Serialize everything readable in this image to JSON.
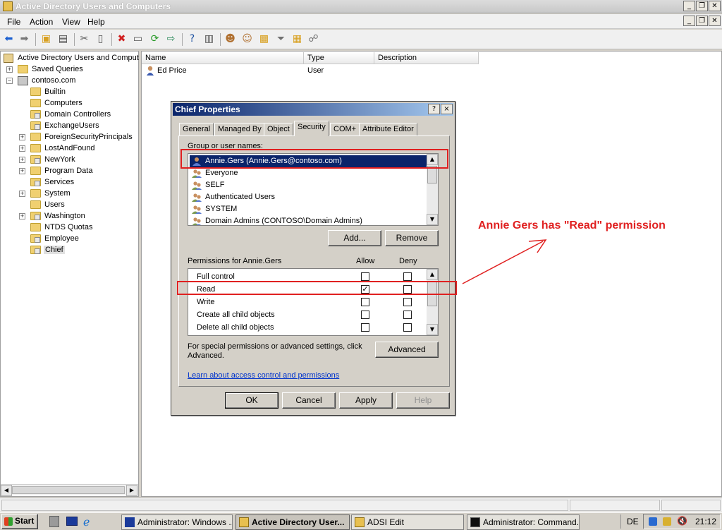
{
  "window": {
    "title": "Active Directory Users and Computers"
  },
  "menu": [
    "File",
    "Action",
    "View",
    "Help"
  ],
  "tree": {
    "root": "Active Directory Users and Comput",
    "items": [
      "Saved Queries",
      "contoso.com",
      "Builtin",
      "Computers",
      "Domain Controllers",
      "ExchangeUsers",
      "ForeignSecurityPrincipals",
      "LostAndFound",
      "NewYork",
      "Program Data",
      "Services",
      "System",
      "Users",
      "Washington",
      "NTDS Quotas",
      "Employee",
      "Chief"
    ]
  },
  "list": {
    "headers": {
      "name": "Name",
      "type": "Type",
      "description": "Description"
    },
    "rows": [
      {
        "name": "Ed Price",
        "type": "User",
        "description": ""
      }
    ]
  },
  "dialog": {
    "title": "Chief Properties",
    "help": "?",
    "close": "×",
    "tabs": [
      "General",
      "Managed By",
      "Object",
      "Security",
      "COM+",
      "Attribute Editor"
    ],
    "group_label": "Group or user names:",
    "users": [
      "Annie.Gers (Annie.Gers@contoso.com)",
      "Everyone",
      "SELF",
      "Authenticated Users",
      "SYSTEM",
      "Domain Admins (CONTOSO\\Domain Admins)"
    ],
    "add": "Add...",
    "remove": "Remove",
    "perm_label": "Permissions for Annie.Gers",
    "allow": "Allow",
    "deny": "Deny",
    "permissions": [
      {
        "name": "Full control",
        "allow": "",
        "deny": ""
      },
      {
        "name": "Read",
        "allow": "✓",
        "deny": ""
      },
      {
        "name": "Write",
        "allow": "",
        "deny": ""
      },
      {
        "name": "Create all child objects",
        "allow": "",
        "deny": ""
      },
      {
        "name": "Delete all child objects",
        "allow": "",
        "deny": ""
      }
    ],
    "special_text": "For special permissions or advanced settings, click Advanced.",
    "advanced": "Advanced",
    "learn_link": "Learn about access control and permissions",
    "ok": "OK",
    "cancel": "Cancel",
    "apply": "Apply",
    "helpbtn": "Help"
  },
  "annotation": "Annie Gers has \"Read\" permission",
  "taskbar": {
    "start": "Start",
    "tasks": [
      "Administrator: Windows ...",
      "Active Directory User...",
      "ADSI Edit",
      "Administrator: Command..."
    ],
    "lang": "DE",
    "time": "21:12"
  },
  "colors": {
    "annotation": "#e02020",
    "selection": "#0a246a"
  }
}
